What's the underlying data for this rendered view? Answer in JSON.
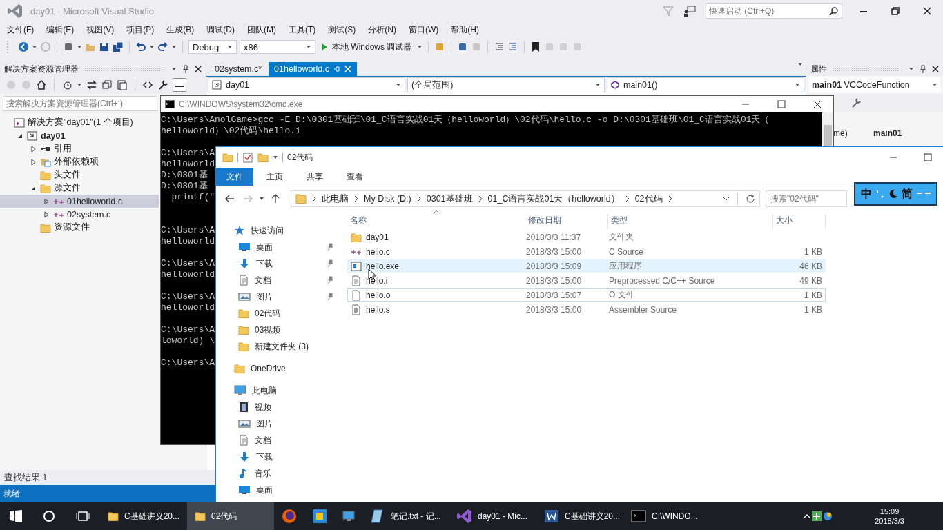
{
  "vs": {
    "title": "day01 - Microsoft Visual Studio",
    "quick_launch": {
      "placeholder": "快速启动 (Ctrl+Q)"
    },
    "menu": [
      "文件(F)",
      "编辑(E)",
      "视图(V)",
      "项目(P)",
      "生成(B)",
      "调试(D)",
      "团队(M)",
      "工具(T)",
      "测试(S)",
      "分析(N)",
      "窗口(W)",
      "帮助(H)"
    ],
    "toolbar": {
      "configuration": "Debug",
      "platform": "x86",
      "run_button": "本地 Windows 调试器"
    },
    "solution_explorer": {
      "title": "解决方案资源管理器",
      "search": {
        "placeholder": "搜索解决方案资源管理器(Ctrl+;)"
      },
      "tree": [
        {
          "kind": "solution",
          "label": "解决方案\"day01\"(1 个项目)",
          "selected": false,
          "children": [
            {
              "kind": "project",
              "label": "day01",
              "expanded": true,
              "selected": false,
              "children": [
                {
                  "kind": "references",
                  "label": "引用",
                  "expanded": false,
                  "selected": false
                },
                {
                  "kind": "external",
                  "label": "外部依赖项",
                  "expanded": false,
                  "selected": false
                },
                {
                  "kind": "filter",
                  "label": "头文件",
                  "selected": false
                },
                {
                  "kind": "filter",
                  "label": "源文件",
                  "expanded": true,
                  "selected": false,
                  "children": [
                    {
                      "kind": "cfile",
                      "label": "01helloworld.c",
                      "expanded": false,
                      "selected": true
                    },
                    {
                      "kind": "cfile",
                      "label": "02system.c",
                      "expanded": false,
                      "selected": false
                    }
                  ]
                },
                {
                  "kind": "filter",
                  "label": "资源文件",
                  "selected": false
                }
              ]
            }
          ]
        }
      ]
    },
    "tabs": [
      {
        "label": "02system.c*",
        "selected": false
      },
      {
        "label": "01helloworld.c",
        "selected": true
      }
    ],
    "navbar": {
      "project": "day01",
      "scope": "(全局范围)",
      "member": "main01()"
    },
    "properties": {
      "title": "属性",
      "object_name": "main01",
      "object_type": "VCCodeFunction",
      "rows": [
        {
          "name": "me)",
          "value": "main01"
        }
      ]
    },
    "bottom_tab": "查找结果 1",
    "status": "就绪"
  },
  "cmd": {
    "title": "C:\\WINDOWS\\system32\\cmd.exe",
    "blocks": [
      [
        "C:\\Users\\AnolGame>gcc -E D:\\0301基础班\\01_C语言实战01天（helloworld）\\02代码\\hello.c -o D:\\0301基础班\\01_C语言实战01天（",
        "helloworld）\\02代码\\hello.i"
      ],
      [
        "C:\\Users\\A",
        "helloworld",
        "D:\\0301基",
        "D:\\0301基",
        "  printf(\""
      ],
      [
        "C:\\Users\\A",
        "helloworld"
      ],
      [
        "C:\\Users\\A",
        "helloworld"
      ],
      [
        "C:\\Users\\A",
        "helloworld"
      ],
      [
        "C:\\Users\\A",
        "loworld) \\"
      ],
      [
        "C:\\Users\\A"
      ]
    ]
  },
  "explorer": {
    "title": "02代码",
    "ribbon_tabs": [
      {
        "label": "文件",
        "selected": true
      },
      {
        "label": "主页",
        "selected": false
      },
      {
        "label": "共享",
        "selected": false
      },
      {
        "label": "查看",
        "selected": false
      }
    ],
    "breadcrumb": [
      "此电脑",
      "My Disk (D:)",
      "0301基础班",
      "01_C语言实战01天（helloworld）",
      "02代码"
    ],
    "search": {
      "placeholder": "搜索\"02代码\""
    },
    "nav": [
      {
        "kind": "star",
        "label": "快速访问",
        "children": [
          {
            "kind": "desktop",
            "label": "桌面",
            "pinned": true
          },
          {
            "kind": "download",
            "label": "下载",
            "pinned": true
          },
          {
            "kind": "document",
            "label": "文档",
            "pinned": true
          },
          {
            "kind": "picture",
            "label": "图片",
            "pinned": true
          },
          {
            "kind": "folder",
            "label": "02代码",
            "pinned": false
          },
          {
            "kind": "folder",
            "label": "03视频",
            "pinned": false
          },
          {
            "kind": "folder",
            "label": "新建文件夹 (3)",
            "pinned": false
          }
        ]
      },
      {
        "kind": "folder",
        "label": "OneDrive"
      },
      {
        "kind": "computer",
        "label": "此电脑",
        "children": [
          {
            "kind": "video",
            "label": "视频"
          },
          {
            "kind": "picture",
            "label": "图片"
          },
          {
            "kind": "document",
            "label": "文档"
          },
          {
            "kind": "download",
            "label": "下载"
          },
          {
            "kind": "music",
            "label": "音乐"
          },
          {
            "kind": "desktop",
            "label": "桌面"
          }
        ]
      }
    ],
    "columns": [
      "名称",
      "修改日期",
      "类型",
      "大小"
    ],
    "files": [
      {
        "kind": "folder",
        "name": "day01",
        "modified": "2018/3/3 11:37",
        "type": "文件夹",
        "hovered": false,
        "selected": false
      },
      {
        "kind": "cfile",
        "name": "hello.c",
        "modified": "2018/3/3 15:00",
        "type": "C Source",
        "size": "1 KB",
        "hovered": false,
        "selected": false
      },
      {
        "kind": "exe",
        "name": "hello.exe",
        "modified": "2018/3/3 15:09",
        "type": "应用程序",
        "size": "46 KB",
        "hovered": true,
        "selected": false
      },
      {
        "kind": "text",
        "name": "hello.i",
        "modified": "2018/3/3 15:00",
        "type": "Preprocessed C/C++ Source",
        "size": "49 KB",
        "hovered": false,
        "selected": false
      },
      {
        "kind": "blank",
        "name": "hello.o",
        "modified": "2018/3/3 15:07",
        "type": "O 文件",
        "size": "1 KB",
        "hovered": false,
        "selected": true
      },
      {
        "kind": "asm",
        "name": "hello.s",
        "modified": "2018/3/3 15:00",
        "type": "Assembler Source",
        "size": "1 KB",
        "hovered": false,
        "selected": false
      }
    ]
  },
  "ime": {
    "mode": "中",
    "script": "简"
  },
  "taskbar": {
    "items": [
      {
        "kind": "folder",
        "label": "C基础讲义20...",
        "selected": false
      },
      {
        "kind": "folder",
        "label": "02代码",
        "selected": true
      },
      {
        "kind": "firefox",
        "selected": false
      },
      {
        "kind": "app",
        "selected": false
      },
      {
        "kind": "monitor",
        "selected": false
      },
      {
        "kind": "notepad",
        "label": "笔记.txt - 记...",
        "selected": false
      },
      {
        "kind": "vs",
        "label": "day01 - Mic...",
        "selected": false
      },
      {
        "kind": "word",
        "label": "C基础讲义20...",
        "selected": false
      },
      {
        "kind": "cmd",
        "label": "C:\\WINDO...",
        "selected": false
      }
    ],
    "time": "15:09",
    "date": "2018/3/3"
  }
}
